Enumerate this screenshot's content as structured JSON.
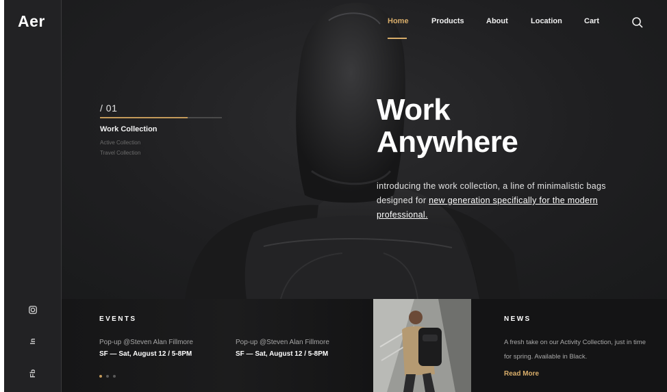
{
  "brand": {
    "logo": "Aer"
  },
  "nav": {
    "items": [
      {
        "label": "Home",
        "active": true
      },
      {
        "label": "Products",
        "active": false
      },
      {
        "label": "About",
        "active": false
      },
      {
        "label": "Location",
        "active": false
      },
      {
        "label": "Cart",
        "active": false
      }
    ],
    "search_icon": "search-icon"
  },
  "social": {
    "instagram_icon": "instagram-icon",
    "linkedin": "In",
    "facebook": "Fb"
  },
  "slider": {
    "number": "/ 01",
    "progress": 0.72,
    "collections": [
      "Work Collection",
      "Active Collection",
      "Travel Collection"
    ]
  },
  "hero": {
    "headline_line1": "Work",
    "headline_line2": "Anywhere",
    "intro_plain": "introducing the work collection, a line of minimalistic bags designed for ",
    "intro_link": "new generation specifically for the modern professional."
  },
  "events": {
    "title": "EVENTS",
    "items": [
      {
        "name": "Pop-up @Steven Alan Fillmore",
        "when": "SF — Sat, August 12 / 5-8PM"
      },
      {
        "name": "Pop-up @Steven Alan Fillmore",
        "when": "SF — Sat, August 12 / 5-8PM"
      }
    ],
    "dots_count": 3,
    "active_dot": 0
  },
  "news": {
    "title": "NEWS",
    "text": "A fresh take on our Activity Collection, just in time for spring. Available in Black.",
    "link": "Read More"
  },
  "colors": {
    "accent": "#d8ad6a",
    "background": "#1e1e20",
    "panel": "#151516"
  }
}
